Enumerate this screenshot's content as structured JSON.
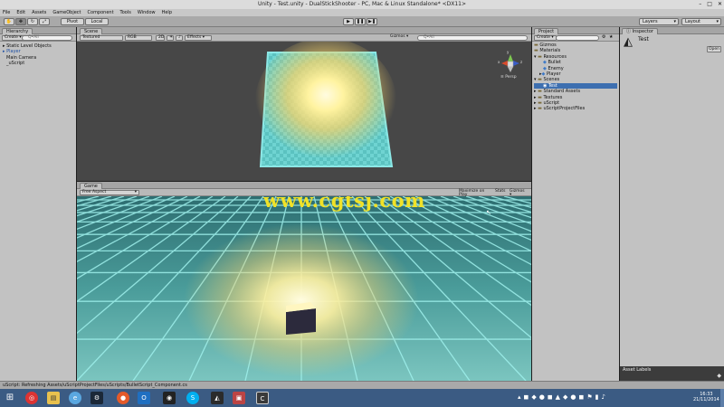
{
  "window": {
    "title": "Unity - Test.unity - DualStickShooter - PC, Mac & Linux Standalone* <DX11>"
  },
  "menu": [
    "File",
    "Edit",
    "Assets",
    "GameObject",
    "Component",
    "Tools",
    "Window",
    "Help"
  ],
  "toolbar": {
    "pivot_label": "Pivot",
    "local_label": "Local",
    "layers_label": "Layers",
    "layout_label": "Layout"
  },
  "hierarchy": {
    "tab": "Hierarchy",
    "create_label": "Create",
    "search_placeholder": "Q•All",
    "items": [
      "Static Level Objects",
      "Player",
      "Main Camera",
      "_uScript"
    ]
  },
  "scene": {
    "tab": "Scene",
    "render_mode": "Textured",
    "color_mode": "RGB",
    "mode_2d": "2D",
    "effects_label": "Effects",
    "gizmos_label": "Gizmos",
    "search_placeholder": "Q•All",
    "persp_label": "Persp",
    "axes": {
      "x": "x",
      "y": "y",
      "z": "z"
    }
  },
  "game": {
    "tab": "Game",
    "aspect": "Free Aspect",
    "maximize_label": "Maximize on Play",
    "stats_label": "Stats",
    "gizmos_label": "Gizmos",
    "watermark": "www.cgtsj.com"
  },
  "project": {
    "tab": "Project",
    "create_label": "Create",
    "search_placeholder": "",
    "tree": [
      {
        "label": "Gizmos",
        "depth": 0
      },
      {
        "label": "Materials",
        "depth": 0
      },
      {
        "label": "Resources",
        "depth": 0
      },
      {
        "label": "Bullet",
        "depth": 1
      },
      {
        "label": "Enemy",
        "depth": 1
      },
      {
        "label": "Player",
        "depth": 1
      },
      {
        "label": "Scenes",
        "depth": 0
      },
      {
        "label": "Test",
        "depth": 1
      },
      {
        "label": "Standard Assets",
        "depth": 0
      },
      {
        "label": "Textures",
        "depth": 0
      },
      {
        "label": "uScript",
        "depth": 0
      },
      {
        "label": "uScriptProjectFiles",
        "depth": 0
      }
    ]
  },
  "inspector": {
    "tab": "Inspector",
    "object_name": "Test",
    "open_label": "Open",
    "asset_labels": "Asset Labels"
  },
  "status": {
    "message": "uScript: Refreshing Assets/uScriptProjectFiles/uScripts/BulletScript_Component.cs"
  },
  "taskbar": {
    "time": "16:33",
    "date": "21/11/2014"
  }
}
